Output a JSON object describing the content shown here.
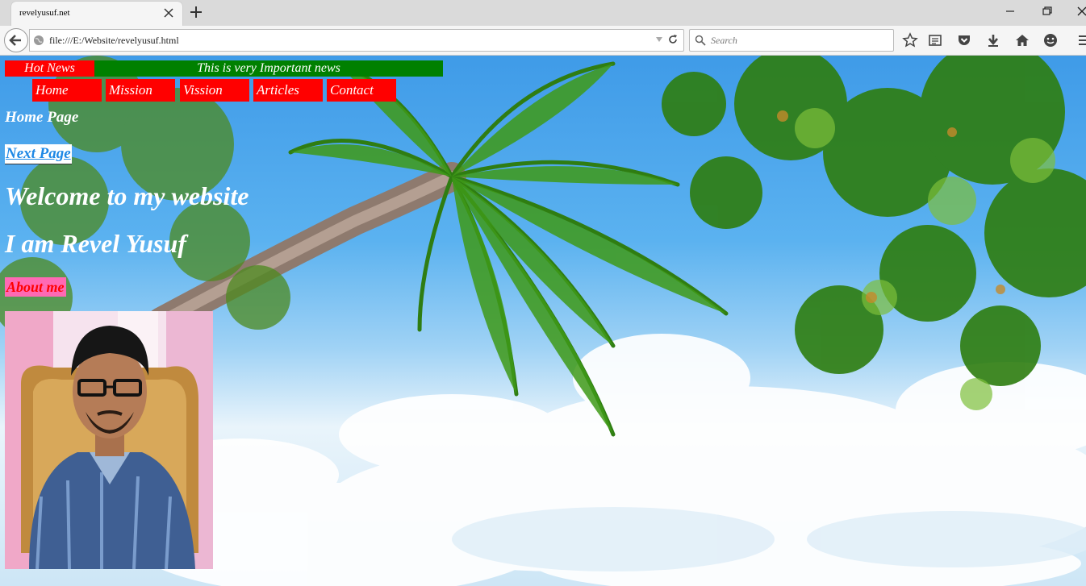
{
  "browser": {
    "tab_title": "revelyusuf.net",
    "url": "file:///E:/Website/revelyusuf.html",
    "search_placeholder": "Search"
  },
  "page": {
    "hot_news_label": "Hot News",
    "news_text": "This is very  Important news",
    "menu": [
      {
        "label": "Home"
      },
      {
        "label": "Mission"
      },
      {
        "label": "Vission"
      },
      {
        "label": "Articles"
      },
      {
        "label": "Contact"
      }
    ],
    "home_page_heading": "Home Page",
    "next_page_link": "Next Page",
    "welcome_heading": "Welcome to my website",
    "name_heading": "I am Revel Yusuf",
    "about_me": "About me"
  },
  "colors": {
    "news_label_bg": "#ff0000",
    "news_ticker_bg": "#008000",
    "menu_bg": "#ff0000",
    "about_bg": "#ff69b4",
    "link": "#1e88e5"
  }
}
